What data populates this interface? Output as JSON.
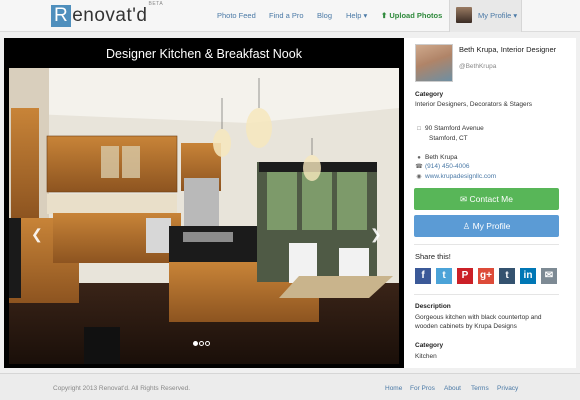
{
  "nav": {
    "logo_letter": "R",
    "logo_rest": "enovat'd",
    "beta": "BETA",
    "photo_feed": "Photo Feed",
    "find_a_pro": "Find a Pro",
    "blog": "Blog",
    "help": "Help ▾",
    "upload": "⬆ Upload Photos",
    "my_profile": "My Profile ▾"
  },
  "photo": {
    "title": "Designer Kitchen & Breakfast Nook",
    "prev": "❮",
    "next": "❯",
    "slide_count": 3,
    "active_slide": 1
  },
  "pro": {
    "name": "Beth Krupa, Interior Designer",
    "handle": "@BethKrupa",
    "category_label": "Category",
    "category_value": "Interior Designers, Decorators & Stagers",
    "address_line1": "90 Stamford Avenue",
    "address_line2": "Stamford, CT",
    "contact_name": "Beth Krupa",
    "phone": "(914) 450-4006",
    "website": "www.krupadesignllc.com",
    "contact_button": "Contact Me",
    "profile_button": "My Profile"
  },
  "share": {
    "label": "Share this!",
    "icons": [
      "f",
      "t",
      "P",
      "g+",
      "t",
      "in",
      "✉"
    ],
    "colors": [
      "#3b5998",
      "#4ba3d8",
      "#cb2027",
      "#dd4b39",
      "#34526f",
      "#0077b5",
      "#7d8a94"
    ]
  },
  "description": {
    "label": "Description",
    "text": "Gorgeous kitchen with black countertop and wooden cabinets by Krupa Designs",
    "category_label": "Category",
    "category_value": "Kitchen"
  },
  "footer": {
    "copyright": "Copyright 2013 Renovat'd. All Rights Reserved.",
    "home": "Home",
    "for_pros": "For Pros",
    "about": "About",
    "terms": "Terms",
    "privacy": "Privacy"
  }
}
